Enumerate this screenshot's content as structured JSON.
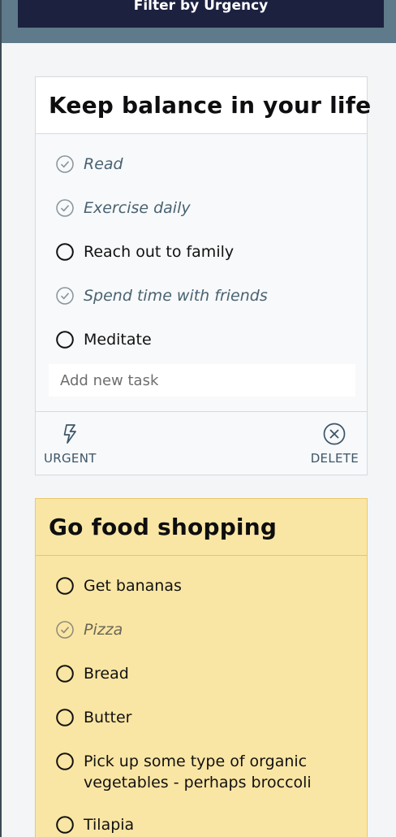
{
  "header": {
    "filter_button_label": "Filter by Urgency"
  },
  "lists": [
    {
      "title": "Keep balance in your life",
      "tasks": [
        {
          "label": "Read",
          "done": true
        },
        {
          "label": "Exercise daily",
          "done": true
        },
        {
          "label": "Reach out to family",
          "done": false
        },
        {
          "label": "Spend time with friends",
          "done": true
        },
        {
          "label": "Meditate",
          "done": false
        }
      ],
      "add_placeholder": "Add new task",
      "actions": {
        "urgent_label": "URGENT",
        "delete_label": "DELETE"
      }
    },
    {
      "title": "Go food shopping",
      "urgent": true,
      "tasks": [
        {
          "label": "Get bananas",
          "done": false
        },
        {
          "label": "Pizza",
          "done": true
        },
        {
          "label": "Bread",
          "done": false
        },
        {
          "label": "Butter",
          "done": false
        },
        {
          "label": "Pick up some type of organic vegetables - perhaps broccoli",
          "done": false
        },
        {
          "label": "Tilapia",
          "done": false
        }
      ]
    }
  ],
  "colors": {
    "header_button_bg": "#1c2140",
    "header_band": "#5f7a8a",
    "urgent_card_bg": "#fae6a4",
    "done_text": "#4a6270"
  },
  "icons": {
    "done": "check-circle-icon",
    "todo": "circle-icon",
    "urgent": "lightning-icon",
    "delete": "x-circle-icon"
  }
}
